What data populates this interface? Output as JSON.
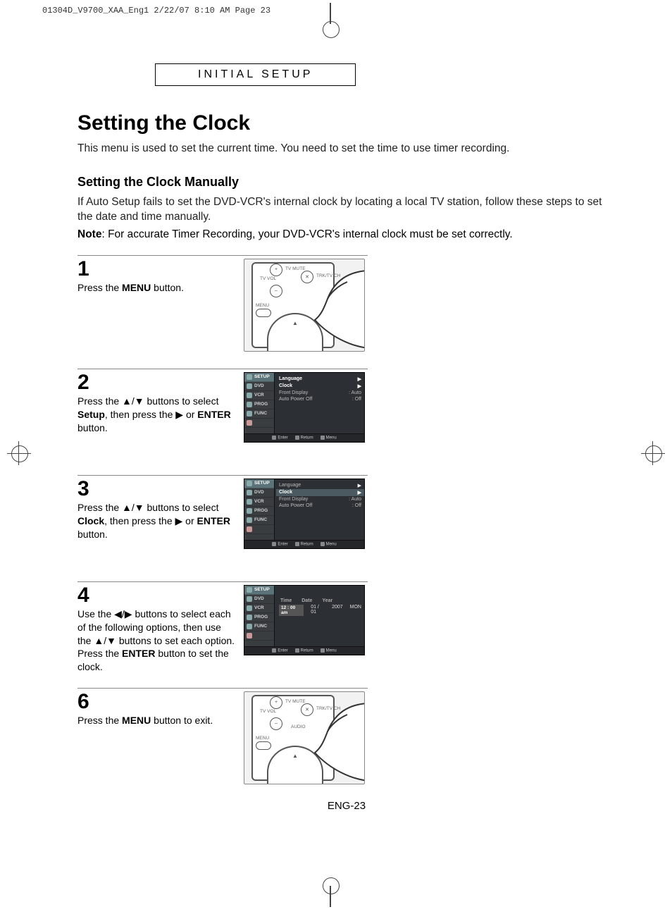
{
  "print_header": "01304D_V9700_XAA_Eng1  2/22/07  8:10 AM  Page 23",
  "section_label": "INITIAL SETUP",
  "title": "Setting the Clock",
  "intro": "This menu is used to set the current time. You need to set the time to use timer recording.",
  "subheading": "Setting the Clock Manually",
  "manual_intro": "If Auto Setup fails to set the DVD-VCR's internal clock by locating a local TV station, follow these steps to set the date and time manually.",
  "note_label": "Note",
  "note_text": ": For accurate Timer Recording, your DVD-VCR's internal clock must be set correctly.",
  "steps": {
    "s1": {
      "num": "1",
      "text_a": "Press the ",
      "bold": "MENU",
      "text_b": " button."
    },
    "s2": {
      "num": "2",
      "text_a": "Press the ▲/▼ buttons to select ",
      "bold": "Setup",
      "text_b": ", then press the ▶ or ",
      "bold2": "ENTER",
      "text_c": " button."
    },
    "s3": {
      "num": "3",
      "text_a": "Press the ▲/▼ buttons to select ",
      "bold": "Clock",
      "text_b": ", then press the ▶ or ",
      "bold2": "ENTER",
      "text_c": " button."
    },
    "s4": {
      "num": "4",
      "text_a": "Use the ◀/▶ buttons to select each of the following options, then use the ▲/▼ buttons to set each option.",
      "text_b": "Press the ",
      "bold": "ENTER",
      "text_c": " button to set the clock."
    },
    "s6": {
      "num": "6",
      "text_a": "Press the ",
      "bold": "MENU",
      "text_b": " button to exit."
    }
  },
  "remote": {
    "tv_mute": "TV MUTE",
    "tv_vol": "TV VOL",
    "trk": "TRK/TV CH",
    "audio": "AUDIO",
    "menu": "MENU",
    "plus": "+",
    "minus": "–",
    "mute_icon": "mute",
    "up": "▲"
  },
  "osd": {
    "side": [
      "SETUP",
      "DVD",
      "VCR",
      "PROG",
      "FUNC"
    ],
    "setup_rows": [
      {
        "label": "Language",
        "val": "",
        "arrow": true
      },
      {
        "label": "Clock",
        "val": "",
        "arrow": true
      },
      {
        "label": "Front Display",
        "val": ": Auto",
        "arrow": false
      },
      {
        "label": "Auto Power Off",
        "val": ": Off",
        "arrow": false
      }
    ],
    "clock_labels": [
      "Time",
      "Date",
      "Year",
      ""
    ],
    "clock_values": [
      "12 : 00 am",
      "01 / 01",
      "2007",
      "MON"
    ],
    "footer": [
      "Enter",
      "Return",
      "Menu"
    ]
  },
  "page_number": "ENG-23"
}
